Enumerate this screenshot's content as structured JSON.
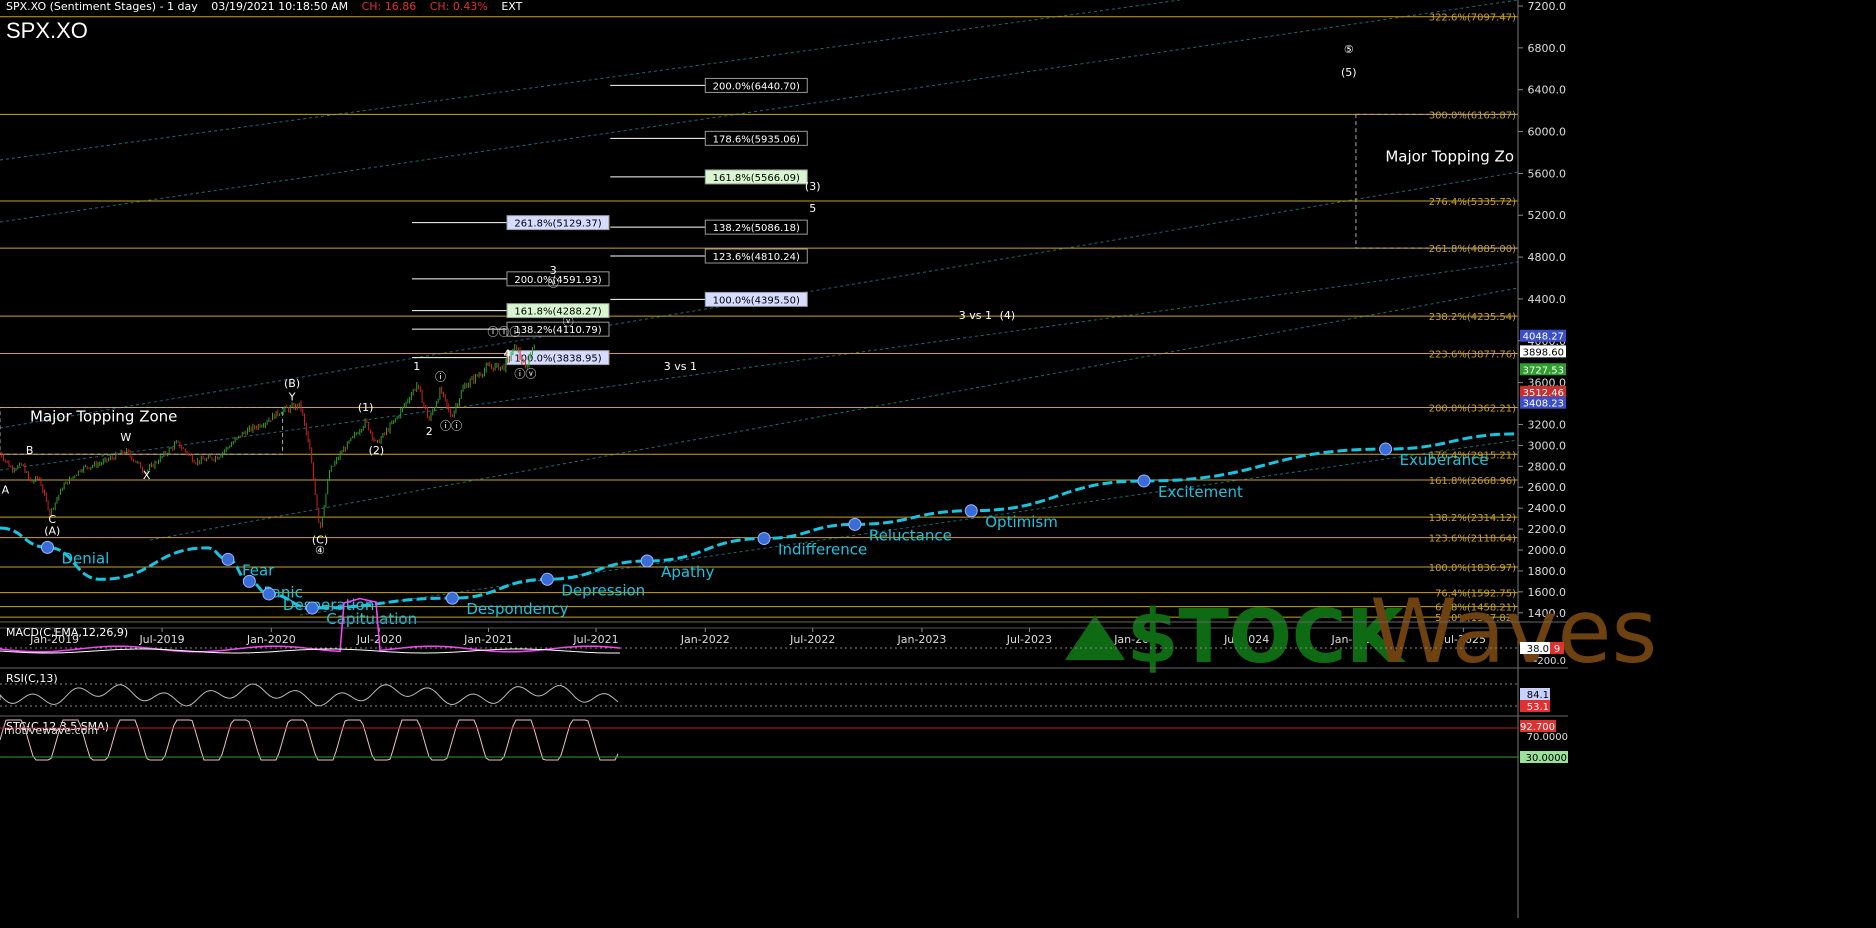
{
  "header": {
    "title": "SPX.XO (Sentiment Stages) - 1 day",
    "datetime": "03/19/2021 10:18:50 AM",
    "change": "CH: 16.86",
    "change_pct": "CH: 0.43%",
    "session": "EXT",
    "symbol": "SPX.XO"
  },
  "watermark": "motivewave.com",
  "brand": {
    "part1": "$TOCK",
    "part2": "Waves"
  },
  "colors": {
    "price_up": "#2e9e2e",
    "price_down": "#d22020",
    "fib": "#c9a227",
    "sentiment": "#19c4e0",
    "dots": "#3a6cd8",
    "macd": "#ff40ff"
  },
  "chart_data": [
    {
      "type": "line",
      "name": "main",
      "ylim": [
        1350,
        7200
      ],
      "x_start": "2018-10-01",
      "x_end": "2025-10-01",
      "y_ticks": [
        1400,
        1600,
        1800,
        2000,
        2200,
        2400,
        2600,
        2800,
        3000,
        3200,
        3600,
        4000,
        4400,
        4800,
        5200,
        5600,
        6000,
        6400,
        6800,
        7200
      ],
      "x_ticks": [
        {
          "date": "2019-01-01",
          "label": "Jan-2019"
        },
        {
          "date": "2019-07-01",
          "label": "Jul-2019"
        },
        {
          "date": "2020-01-01",
          "label": "Jan-2020"
        },
        {
          "date": "2020-07-01",
          "label": "Jul-2020"
        },
        {
          "date": "2021-01-01",
          "label": "Jan-2021"
        },
        {
          "date": "2021-07-01",
          "label": "Jul-2021"
        },
        {
          "date": "2022-01-01",
          "label": "Jan-2022"
        },
        {
          "date": "2022-07-01",
          "label": "Jul-2022"
        },
        {
          "date": "2023-01-01",
          "label": "Jan-2023"
        },
        {
          "date": "2023-07-01",
          "label": "Jul-2023"
        },
        {
          "date": "2024-01-01",
          "label": "Jan-2024"
        },
        {
          "date": "2024-07-01",
          "label": "Jul-2024"
        },
        {
          "date": "2025-01-01",
          "label": "Jan-2025"
        },
        {
          "date": "2025-07-01",
          "label": "Jul-2025"
        }
      ],
      "fib_levels": [
        {
          "label": "322.6%(7097.47)",
          "value": 7097.47
        },
        {
          "label": "300.0%(6163.87)",
          "value": 6163.87
        },
        {
          "label": "276.4%(5335.72)",
          "value": 5335.72
        },
        {
          "label": "261.8%(4885.00)",
          "value": 4885.0
        },
        {
          "label": "238.2%(4235.54)",
          "value": 4235.54
        },
        {
          "label": "223.6%(3877.76)",
          "value": 3877.76
        },
        {
          "label": "200.0%(3362.21)",
          "value": 3362.21
        },
        {
          "label": "176.4%(2915.21)",
          "value": 2915.21
        },
        {
          "label": "161.8%(2668.96)",
          "value": 2668.96
        },
        {
          "label": "138.2%(2314.12)",
          "value": 2314.12
        },
        {
          "label": "123.6%(2118.64)",
          "value": 2118.64
        },
        {
          "label": "100.0%(1836.97)",
          "value": 1836.97
        },
        {
          "label": "76.4%(1592.75)",
          "value": 1592.75
        },
        {
          "label": "61.8%(1458.21)",
          "value": 1458.21
        },
        {
          "label": "50.0%(1357.82)",
          "value": 1357.82
        }
      ],
      "fib_boxes": [
        {
          "label": "200.0%(6440.70)",
          "value": 6440.7,
          "date": "2022-01-01",
          "hl": "none"
        },
        {
          "label": "178.6%(5935.06)",
          "value": 5935.06,
          "date": "2022-01-01",
          "hl": "none"
        },
        {
          "label": "161.8%(5566.09)",
          "value": 5566.09,
          "date": "2022-01-01",
          "hl": "green"
        },
        {
          "label": "138.2%(5086.18)",
          "value": 5086.18,
          "date": "2022-01-01",
          "hl": "none"
        },
        {
          "label": "123.6%(4810.24)",
          "value": 4810.24,
          "date": "2022-01-01",
          "hl": "none"
        },
        {
          "label": "100.0%(4395.50)",
          "value": 4395.5,
          "date": "2022-01-01",
          "hl": "blue"
        },
        {
          "label": "261.8%(5129.37)",
          "value": 5129.37,
          "date": "2021-02-01",
          "hl": "blue"
        },
        {
          "label": "200.0%(4591.93)",
          "value": 4591.93,
          "date": "2021-02-01",
          "hl": "none"
        },
        {
          "label": "161.8%(4288.27)",
          "value": 4288.27,
          "date": "2021-02-01",
          "hl": "green"
        },
        {
          "label": "138.2%(4110.79)",
          "value": 4110.79,
          "date": "2021-02-01",
          "hl": "none"
        },
        {
          "label": "100.0%(3838.95)",
          "value": 3838.95,
          "date": "2021-02-01",
          "hl": "blue"
        }
      ],
      "price_markers": [
        {
          "label": "4048.27",
          "value": 4048.27,
          "color": "#3b4fc8"
        },
        {
          "label": "3898.60",
          "value": 3898.6,
          "color": "#ffffff"
        },
        {
          "label": "3727.53",
          "value": 3727.53,
          "color": "#2e9e2e"
        },
        {
          "label": "3512.46",
          "value": 3512.46,
          "color": "#c83030"
        },
        {
          "label": "3408.23",
          "value": 3408.23,
          "color": "#3b4fc8"
        }
      ],
      "topping_zones": [
        {
          "label": "Major Topping Zone",
          "x0": "2018-10-01",
          "x1": "2020-01-20",
          "y0": 2915,
          "y1": 3362
        },
        {
          "label": "Major Topping Zo",
          "x0": "2025-01-01",
          "x1": "2025-10-01",
          "y0": 4885,
          "y1": 6164
        }
      ],
      "price_series": [
        [
          "2018-10-01",
          2930
        ],
        [
          "2018-10-20",
          2780
        ],
        [
          "2018-11-08",
          2810
        ],
        [
          "2018-11-22",
          2640
        ],
        [
          "2018-12-05",
          2700
        ],
        [
          "2018-12-24",
          2350
        ],
        [
          "2019-01-15",
          2610
        ],
        [
          "2019-02-15",
          2780
        ],
        [
          "2019-03-20",
          2830
        ],
        [
          "2019-05-01",
          2945
        ],
        [
          "2019-06-03",
          2745
        ],
        [
          "2019-07-26",
          3025
        ],
        [
          "2019-08-26",
          2845
        ],
        [
          "2019-10-02",
          2890
        ],
        [
          "2019-11-15",
          3120
        ],
        [
          "2019-12-20",
          3220
        ],
        [
          "2020-01-17",
          3330
        ],
        [
          "2020-02-19",
          3385
        ],
        [
          "2020-03-06",
          2950
        ],
        [
          "2020-03-23",
          2190
        ],
        [
          "2020-04-08",
          2750
        ],
        [
          "2020-04-29",
          2940
        ],
        [
          "2020-06-08",
          3230
        ],
        [
          "2020-06-26",
          3010
        ],
        [
          "2020-07-31",
          3270
        ],
        [
          "2020-09-02",
          3580
        ],
        [
          "2020-09-23",
          3240
        ],
        [
          "2020-10-12",
          3530
        ],
        [
          "2020-10-30",
          3270
        ],
        [
          "2020-11-20",
          3560
        ],
        [
          "2020-12-31",
          3750
        ],
        [
          "2021-01-27",
          3750
        ],
        [
          "2021-02-16",
          3950
        ],
        [
          "2021-03-04",
          3725
        ],
        [
          "2021-03-17",
          3975
        ],
        [
          "2021-03-19",
          3910
        ]
      ],
      "waves": [
        {
          "t": "A",
          "date": "2018-10-10",
          "v": 2540
        },
        {
          "t": "B",
          "date": "2018-11-20",
          "v": 2920
        },
        {
          "t": "C",
          "date": "2018-12-28",
          "v": 2260
        },
        {
          "t": "(A)",
          "date": "2018-12-28",
          "v": 2150
        },
        {
          "t": "W",
          "date": "2019-05-01",
          "v": 3040
        },
        {
          "t": "X",
          "date": "2019-06-05",
          "v": 2680
        },
        {
          "t": "(B)",
          "date": "2020-02-05",
          "v": 3560
        },
        {
          "t": "Y",
          "date": "2020-02-05",
          "v": 3430
        },
        {
          "t": "(C)",
          "date": "2020-03-23",
          "v": 2060
        },
        {
          "t": "④",
          "date": "2020-03-23",
          "v": 1960
        },
        {
          "t": "(1)",
          "date": "2020-06-08",
          "v": 3330
        },
        {
          "t": "(2)",
          "date": "2020-06-26",
          "v": 2920
        },
        {
          "t": "1",
          "date": "2020-09-02",
          "v": 3720
        },
        {
          "t": "2",
          "date": "2020-09-23",
          "v": 3100
        },
        {
          "t": "ⓘ",
          "date": "2020-10-12",
          "v": 3620
        },
        {
          "t": "ⓘⓘ",
          "date": "2020-10-30",
          "v": 3150
        },
        {
          "t": "ⓘⓘⓘ",
          "date": "2021-01-27",
          "v": 4050
        },
        {
          "t": "ⓘⓥ",
          "date": "2021-03-04",
          "v": 3650
        },
        {
          "t": "3",
          "date": "2021-04-20",
          "v": 4640
        },
        {
          "t": "ⓥ",
          "date": "2021-04-20",
          "v": 4520
        },
        {
          "t": "ⓥ",
          "date": "2021-05-15",
          "v": 4150
        },
        {
          "t": "4",
          "date": "2021-02-01",
          "v": 3840
        },
        {
          "t": "3 vs 1",
          "date": "2021-11-20",
          "v": 3720
        },
        {
          "t": "(3)",
          "date": "2022-07-01",
          "v": 5440
        },
        {
          "t": "5",
          "date": "2022-07-01",
          "v": 5230
        },
        {
          "t": "3 vs 1",
          "date": "2023-04-01",
          "v": 4210
        },
        {
          "t": "(4)",
          "date": "2023-05-25",
          "v": 4210
        },
        {
          "t": "⑤",
          "date": "2024-12-20",
          "v": 6750
        },
        {
          "t": "(5)",
          "date": "2024-12-20",
          "v": 6530
        }
      ]
    },
    {
      "type": "line",
      "name": "sentiment_cycle",
      "ylim": [
        1350,
        7200
      ],
      "stages": [
        {
          "label": "Denial",
          "date": "2018-12-20",
          "v": 2025
        },
        {
          "label": "Fear",
          "date": "2019-10-20",
          "v": 1910
        },
        {
          "label": "Panic",
          "date": "2019-11-25",
          "v": 1700
        },
        {
          "label": "Desperation",
          "date": "2019-12-28",
          "v": 1580
        },
        {
          "label": "Capitulation",
          "date": "2020-03-10",
          "v": 1445
        },
        {
          "label": "Despondency",
          "date": "2020-11-01",
          "v": 1540
        },
        {
          "label": "Depression",
          "date": "2021-04-10",
          "v": 1720
        },
        {
          "label": "Apathy",
          "date": "2021-09-25",
          "v": 1895
        },
        {
          "label": "Indifference",
          "date": "2022-04-10",
          "v": 2110
        },
        {
          "label": "Reluctance",
          "date": "2022-09-10",
          "v": 2245
        },
        {
          "label": "Optimism",
          "date": "2023-03-25",
          "v": 2375
        },
        {
          "label": "Excitement",
          "date": "2024-01-10",
          "v": 2660
        },
        {
          "label": "Exuberance",
          "date": "2025-02-20",
          "v": 2965
        }
      ]
    },
    {
      "type": "line",
      "name": "MACD",
      "label": "MACD(C,EMA,12,26,9)",
      "values_shown": [
        "38.0",
        "9",
        "-200.0"
      ]
    },
    {
      "type": "line",
      "name": "RSI",
      "label": "RSI(C,13)",
      "values_shown": [
        "84.1",
        "53.1"
      ]
    },
    {
      "type": "line",
      "name": "STC",
      "label": "STC(C,12,3,5,SMA)",
      "values_shown": [
        "92.700",
        "70.0000",
        "30.0000"
      ]
    }
  ]
}
